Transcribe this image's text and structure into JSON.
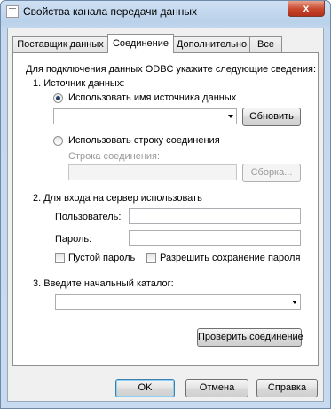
{
  "window": {
    "title": "Свойства канала передачи данных",
    "close_glyph": "x"
  },
  "tabs": [
    {
      "label": "Поставщик данных"
    },
    {
      "label": "Соединение"
    },
    {
      "label": "Дополнительно"
    },
    {
      "label": "Все"
    }
  ],
  "connection": {
    "instruction": "Для подключения данных ODBC укажите следующие сведения:",
    "section1_label": "1. Источник данных:",
    "use_dsn_label": "Использовать имя источника данных",
    "dsn_value": "",
    "refresh_label": "Обновить",
    "use_conn_string_label": "Использовать строку соединения",
    "conn_string_label": "Строка соединения:",
    "conn_string_value": "",
    "build_label": "Сборка...",
    "section2_label": "2. Для входа на сервер использовать",
    "user_label": "Пользователь:",
    "user_value": "",
    "password_label": "Пароль:",
    "password_value": "",
    "blank_password_label": "Пустой пароль",
    "allow_save_password_label": "Разрешить сохранение пароля",
    "section3_label": "3. Введите начальный каталог:",
    "catalog_value": "",
    "test_connection_label": "Проверить соединение"
  },
  "footer": {
    "ok_label": "OK",
    "cancel_label": "Отмена",
    "help_label": "Справка"
  }
}
